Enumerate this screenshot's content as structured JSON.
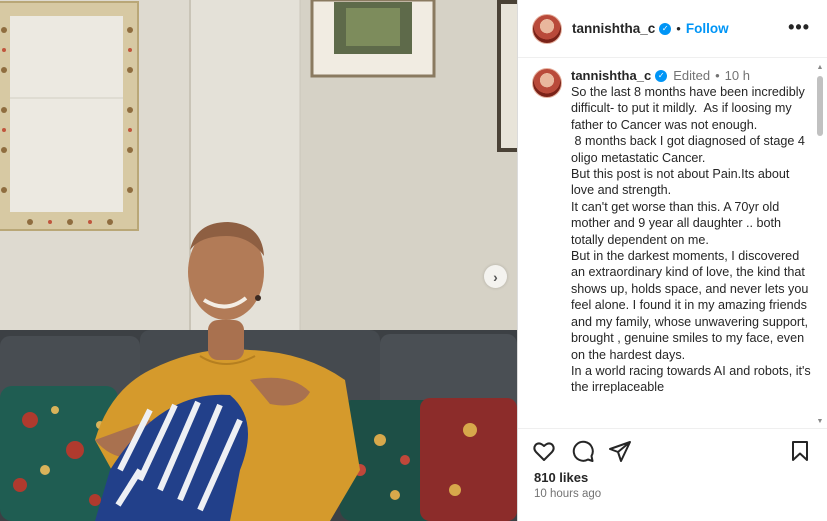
{
  "post": {
    "username": "tannishtha_c",
    "follow_label": "Follow",
    "more_label": "•••",
    "edited_label": "Edited",
    "time_short": "10 h",
    "caption": "So the last 8 months have been incredibly difficult- to put it mildly.  As if loosing my father to Cancer was not enough.\n 8 months back I got diagnosed of stage 4 oligo metastatic Cancer.\nBut this post is not about Pain.Its about love and strength.\nIt can't get worse than this. A 70yr old mother and 9 year all daughter .. both totally dependent on me.\nBut in the darkest moments, I discovered an extraordinary kind of love, the kind that shows up, holds space, and never lets you feel alone. I found it in my amazing friends and my family, whose unwavering support, brought , genuine smiles to my face, even on the hardest days.\nIn a world racing towards AI and robots, it's the irreplaceable",
    "likes_text": "810 likes",
    "time_long": "10 hours ago"
  },
  "icons": {
    "verified": "verified-badge-icon",
    "like": "heart-icon",
    "comment": "comment-icon",
    "share": "send-icon",
    "save": "bookmark-icon",
    "next": "chevron-right-icon"
  },
  "colors": {
    "accent": "#0095f6",
    "text": "#262626",
    "muted": "#737373",
    "border": "#dbdbdb"
  }
}
